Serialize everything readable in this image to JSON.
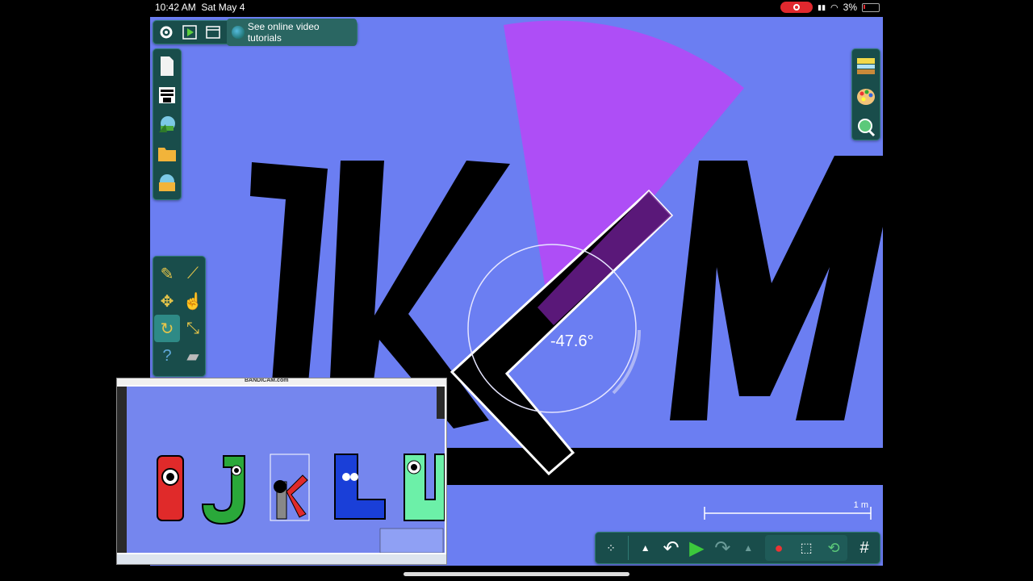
{
  "status_bar": {
    "time": "10:42 AM",
    "date": "Sat May 4",
    "battery": "3%"
  },
  "top_toolbar": {
    "tutorials_label": "See online video tutorials"
  },
  "canvas": {
    "letters": [
      "J",
      "K",
      "M"
    ],
    "angle_readout": "-47.6°",
    "scale_label": "1 m",
    "background_color": "#6b7ef2",
    "arc_color": "#b24cf5"
  },
  "icons": {
    "settings": "gear-icon",
    "play_scene": "play-scene-icon",
    "window": "window-icon",
    "globe": "globe-icon"
  },
  "left_panel": {
    "items": [
      "new-document-icon",
      "layers-icon",
      "world-icon",
      "folder-icon",
      "toolbox-icon"
    ]
  },
  "tool_panel": {
    "tools": [
      "sketch-tool-icon",
      "knife-tool-icon",
      "move-tool-icon",
      "drag-tool-icon",
      "rotate-tool-icon",
      "scale-tool-icon",
      "help-tool-icon",
      "eraser-tool-icon"
    ],
    "active": "rotate-tool-icon"
  },
  "right_panel": {
    "items": [
      "background-icon",
      "palette-icon",
      "zoom-icon"
    ]
  },
  "bottom_bar": {
    "items": [
      "menu-grid-icon",
      "up-arrow-icon",
      "undo-icon",
      "play-icon",
      "redo-icon",
      "up-arrow-icon",
      "gravity-icon",
      "eraser-box-icon",
      "link-icon",
      "grid-icon"
    ]
  },
  "pip": {
    "watermark": "BANDICAM.com"
  }
}
